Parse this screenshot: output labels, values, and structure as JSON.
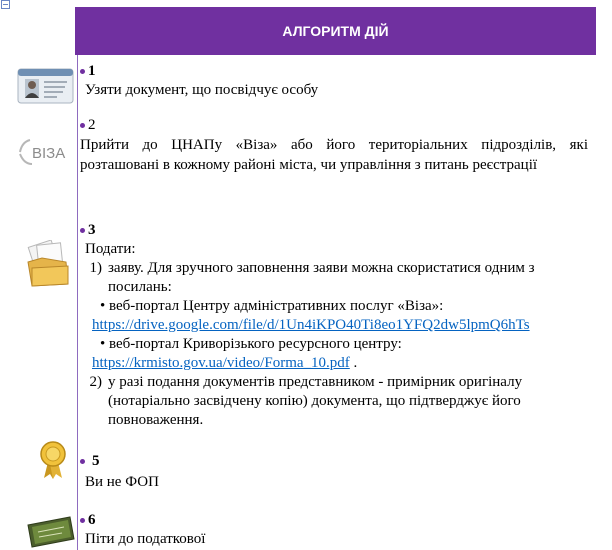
{
  "header": {
    "title": "АЛГОРИТМ ДІЙ"
  },
  "steps": [
    {
      "number": "1",
      "text": "Узяти документ, що посвідчує особу",
      "icon": "id-card-icon"
    },
    {
      "number": "2",
      "text": "Прийти до ЦНАПу «Віза» або його територіальних підрозділів, які розташовані в кожному районі міста, чи  управління з питань реєстрації",
      "icon": "visa-logo-icon",
      "logo_text": "ВІЗА"
    },
    {
      "number": "3",
      "intro": "Подати:",
      "icon": "documents-folder-icon",
      "items": [
        {
          "n": "1)",
          "text": "заяву. Для зручного заповнення заяви можна скористатися одним з посилань:",
          "links": [
            {
              "label": "• веб-портал Центру адміністративних послуг «Віза»:",
              "url": "https://drive.google.com/file/d/1Un4iKPO40Ti8eo1YFQ2dw5lpmQ6hTs"
            },
            {
              "label": "• веб-портал Криворізького ресурсного центру:",
              "url": "https://krmisto.gov.ua/video/Forma_10.pdf",
              "after": " ."
            }
          ]
        },
        {
          "n": "2)",
          "text": "у разі подання документів представником - примірник оригіналу (нотаріально засвідчену копію) документа, що підтверджує його повноваження."
        }
      ]
    },
    {
      "number": "5",
      "text": "Ви не ФОП",
      "icon": "award-medal-icon"
    },
    {
      "number": "6",
      "text": "Піти до податкової",
      "icon": "tax-certificate-icon"
    }
  ]
}
